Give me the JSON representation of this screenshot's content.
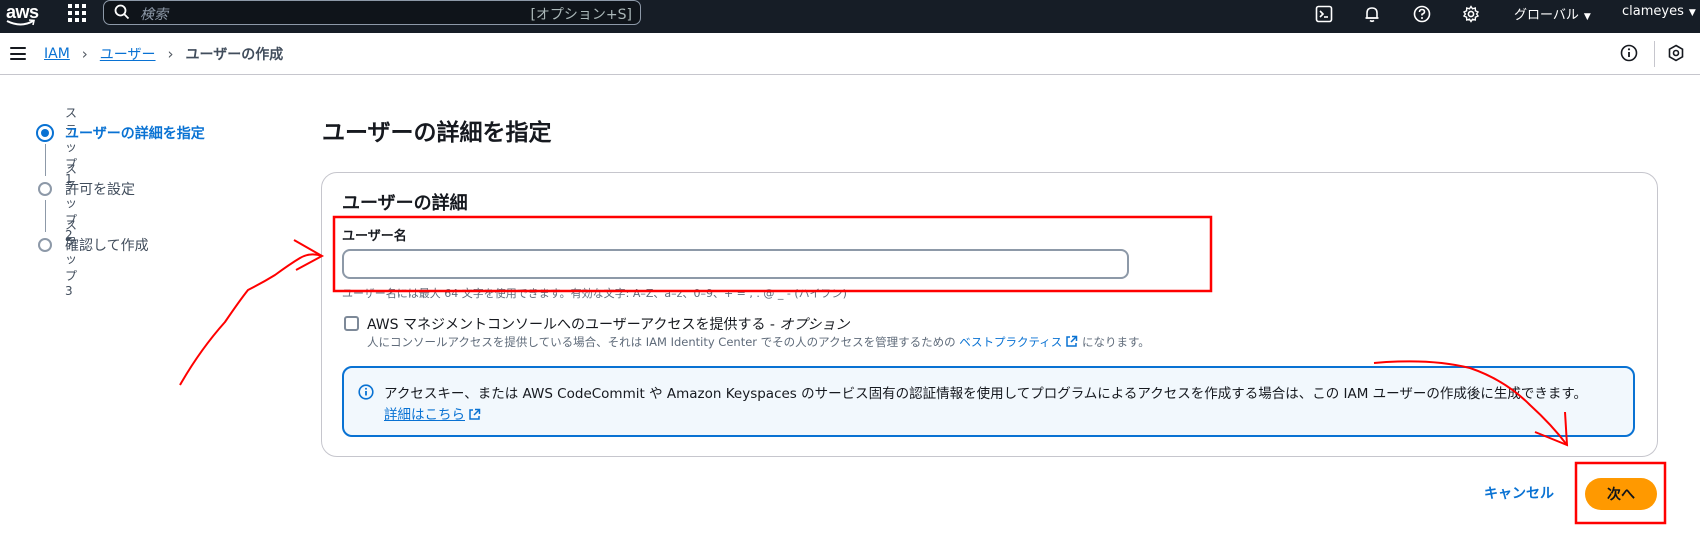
{
  "topnav": {
    "logo_text": "aws",
    "search_placeholder": "検索",
    "search_shortcut": "[オプション+S]",
    "region_label": "グローバル",
    "user_label": "clameyes",
    "icons": [
      "cloudshell-icon",
      "bell-icon",
      "help-icon",
      "gear-icon"
    ]
  },
  "breadcrumb": {
    "items": [
      "IAM",
      "ユーザー"
    ],
    "current": "ユーザーの作成"
  },
  "wizard": {
    "steps": [
      {
        "number": "ステップ 1",
        "title": "ユーザーの詳細を指定",
        "active": true
      },
      {
        "number": "ステップ 2",
        "title": "許可を設定",
        "active": false
      },
      {
        "number": "ステップ 3",
        "title": "確認して作成",
        "active": false
      }
    ]
  },
  "main": {
    "page_title": "ユーザーの詳細を指定",
    "container_title": "ユーザーの詳細",
    "username_label": "ユーザー名",
    "username_value": "",
    "username_hint": "ユーザー名には最大 64 文字を使用できます。有効な文字: A–Z、a–z、0–9、+ = , . @ _ - (ハイフン)",
    "console_access_label": "AWS マネジメントコンソールへのユーザーアクセスを提供する - ",
    "console_access_optional": "オプション",
    "console_desc_before": "人にコンソールアクセスを提供している場合、それは IAM Identity Center でその人のアクセスを管理するための ",
    "console_desc_link": "ベストプラクティス",
    "console_desc_after": " になります。",
    "info_text": "アクセスキー、または AWS CodeCommit や Amazon Keyspaces のサービス固有の認証情報を使用してプログラムによるアクセスを作成する場合は、この IAM ユーザーの作成後に生成できます。",
    "info_link": "詳細はこちら"
  },
  "footer": {
    "cancel_label": "キャンセル",
    "next_label": "次へ"
  },
  "colors": {
    "nav_bg": "#161d26",
    "link": "#0972d3",
    "primary_button": "#ff9900",
    "annotation": "#ff0000"
  }
}
